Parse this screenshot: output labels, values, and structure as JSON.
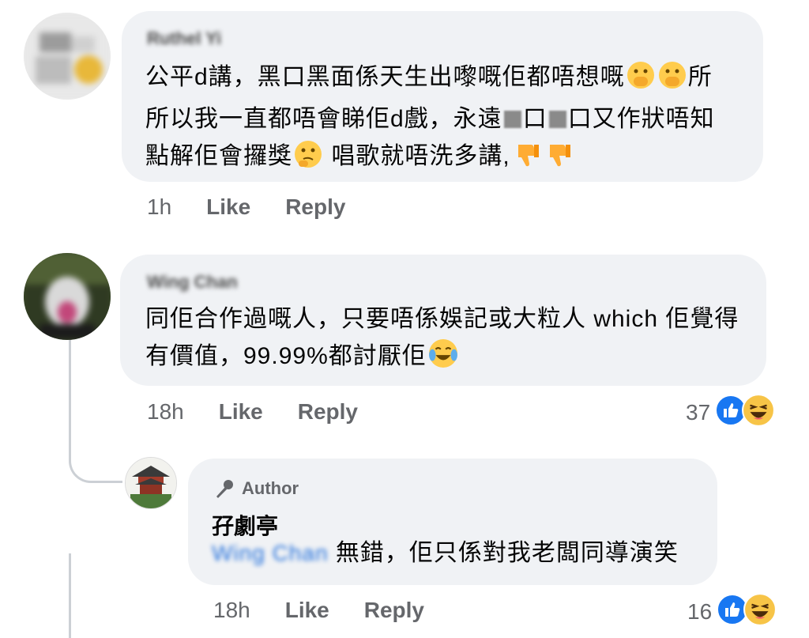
{
  "comments": [
    {
      "author_name": "Ruthel Yi",
      "segments": [
        "公平d講，黑口黑面係天生出嚟嘅佢都唔想嘅",
        "所以我一直都唔會睇佢d戲，永遠",
        "口",
        "口又作狀唔知",
        "點解佢會攞獎",
        "唱歌就唔洗多講,"
      ],
      "time": "1h",
      "like_label": "Like",
      "reply_label": "Reply"
    },
    {
      "author_name": "Wing Chan",
      "line1": "同佢合作過嘅人，只要唔係娛記或大粒人 which 佢覺得",
      "line2": "有價值，99.99%都討厭佢",
      "time": "18h",
      "like_label": "Like",
      "reply_label": "Reply",
      "reaction_count": "37"
    }
  ],
  "reply": {
    "badge": "Author",
    "author_name": "孖劇亭",
    "mention": "Wing Chan",
    "text": "無錯，佢只係對我老闆同導演笑",
    "time": "18h",
    "like_label": "Like",
    "reply_label": "Reply",
    "reaction_count": "16"
  },
  "colors": {
    "bubble": "#f0f2f5",
    "meta": "#65676b",
    "like_blue": "#1877f2",
    "mention": "#216fdb"
  },
  "icons": [
    "face-hand-over-mouth-icon",
    "thinking-face-icon",
    "thumbs-down-icon",
    "tears-of-joy-icon",
    "like-reaction-icon",
    "haha-reaction-icon",
    "microphone-icon"
  ]
}
